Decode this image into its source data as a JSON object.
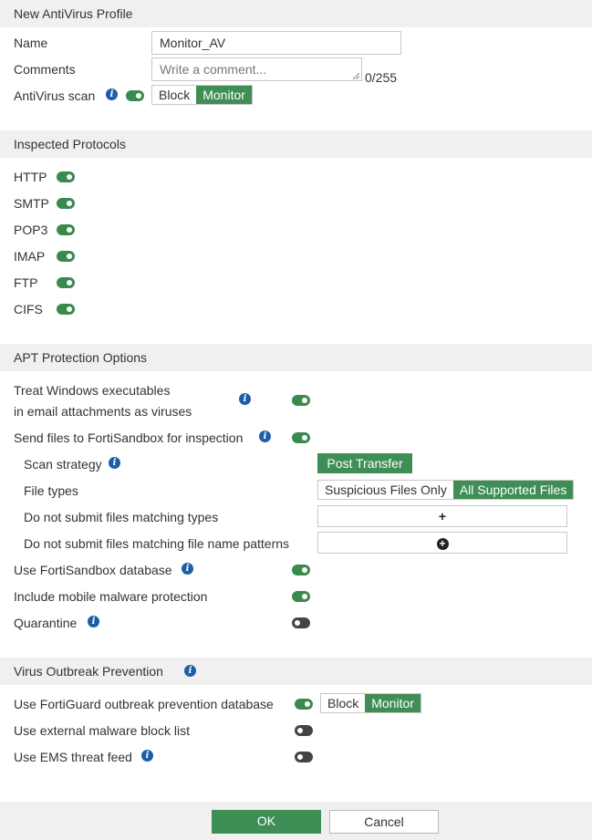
{
  "sections": {
    "profile": "New AntiVirus Profile",
    "protocols": "Inspected Protocols",
    "apt": "APT Protection Options",
    "outbreak": "Virus Outbreak Prevention"
  },
  "profile": {
    "name_label": "Name",
    "name_value": "Monitor_AV",
    "comments_label": "Comments",
    "comments_placeholder": "Write a comment...",
    "comments_count": "0/255",
    "av_scan_label": "AntiVirus scan",
    "av_scan_options": [
      "Block",
      "Monitor"
    ],
    "av_scan_selected": "Monitor"
  },
  "protocols": [
    {
      "label": "HTTP",
      "on": true
    },
    {
      "label": "SMTP",
      "on": true
    },
    {
      "label": "POP3",
      "on": true
    },
    {
      "label": "IMAP",
      "on": true
    },
    {
      "label": "FTP",
      "on": true
    },
    {
      "label": "CIFS",
      "on": true
    }
  ],
  "apt": {
    "treat_exe_line1": "Treat Windows executables",
    "treat_exe_line2": "in email attachments as viruses",
    "send_sandbox": "Send files to FortiSandbox for inspection",
    "scan_strategy": "Scan strategy",
    "scan_strategy_value": "Post Transfer",
    "file_types": "File types",
    "file_types_options": [
      "Suspicious Files Only",
      "All Supported Files"
    ],
    "file_types_selected": "All Supported Files",
    "no_submit_types": "Do not submit files matching types",
    "no_submit_patterns": "Do not submit files matching file name patterns",
    "add_symbol": "+",
    "use_sandbox_db": "Use FortiSandbox database",
    "mobile_malware": "Include mobile malware protection",
    "quarantine": "Quarantine"
  },
  "outbreak": {
    "fortiguard_db": "Use FortiGuard outbreak prevention database",
    "fortiguard_options": [
      "Block",
      "Monitor"
    ],
    "fortiguard_selected": "Monitor",
    "external_list": "Use external malware block list",
    "ems_feed": "Use EMS threat feed"
  },
  "footer": {
    "ok": "OK",
    "cancel": "Cancel"
  },
  "colors": {
    "accent_green": "#3f8e56",
    "info_blue": "#1f5da8",
    "section_bg": "#f0f0f0"
  }
}
